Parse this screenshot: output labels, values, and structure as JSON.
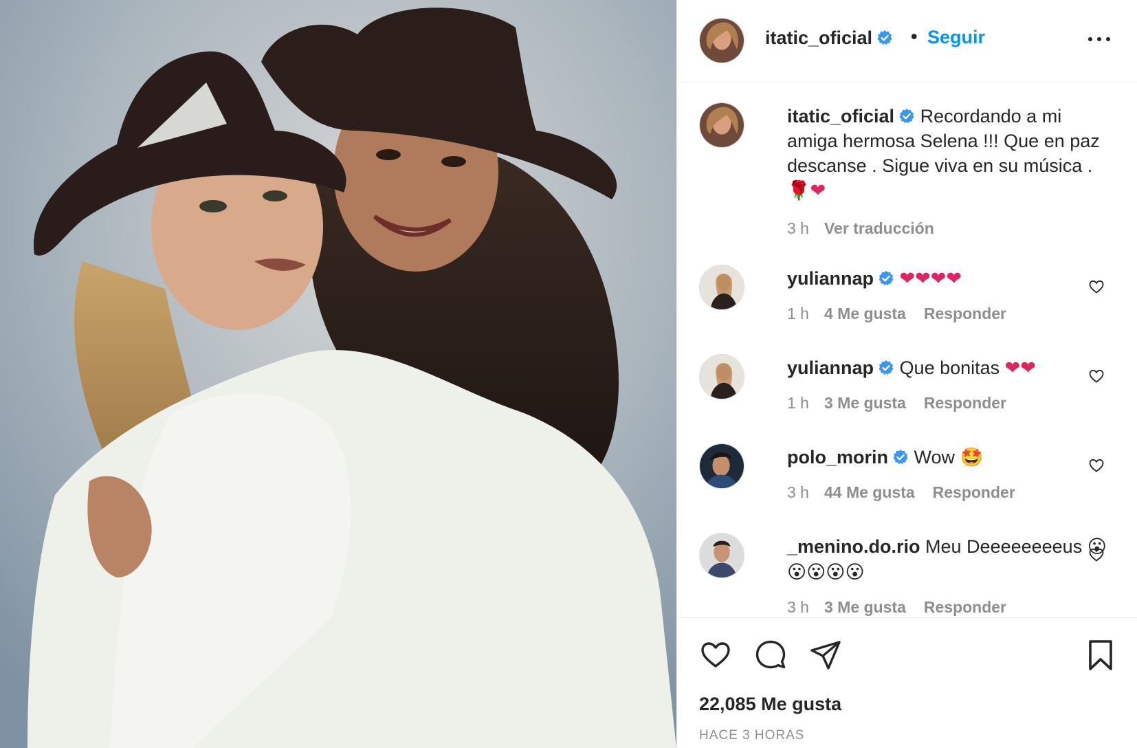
{
  "post": {
    "author": "itatic_oficial",
    "follow_label": "Seguir",
    "separator": "•"
  },
  "caption": {
    "username": "itatic_oficial",
    "text": "Recordando a mi amiga hermosa Selena !!! Que en paz descanse . Sigue viva en su música .",
    "emojis": "🌹❤",
    "time": "3 h",
    "translate_label": "Ver traducción"
  },
  "comments": [
    {
      "username": "yuliannap",
      "text": "❤❤❤❤",
      "time": "1 h",
      "likes": "4 Me gusta",
      "reply": "Responder"
    },
    {
      "username": "yuliannap",
      "text": "Que bonitas",
      "emojis": "❤❤",
      "time": "1 h",
      "likes": "3 Me gusta",
      "reply": "Responder"
    },
    {
      "username": "polo_morin",
      "text": "Wow",
      "emojis": "🤩",
      "time": "3 h",
      "likes": "44 Me gusta",
      "reply": "Responder"
    },
    {
      "username": "_menino.do.rio",
      "text": "Meu Deeeeeeeeus",
      "emojis": "😮😮😮😮😮",
      "time": "3 h",
      "likes": "3 Me gusta",
      "reply": "Responder"
    }
  ],
  "footer": {
    "likes_total": "22,085 Me gusta",
    "time_ago": "HACE 3 HORAS"
  },
  "icons": {
    "like": "heart-icon",
    "comment": "comment-icon",
    "share": "paper-plane-icon",
    "save": "bookmark-icon",
    "more": "more-options-icon",
    "verified": "verified-badge-icon"
  },
  "colors": {
    "link_blue": "#0095f6",
    "verified_blue": "#3897f0",
    "text": "#262626",
    "muted": "#8e8e8e"
  }
}
